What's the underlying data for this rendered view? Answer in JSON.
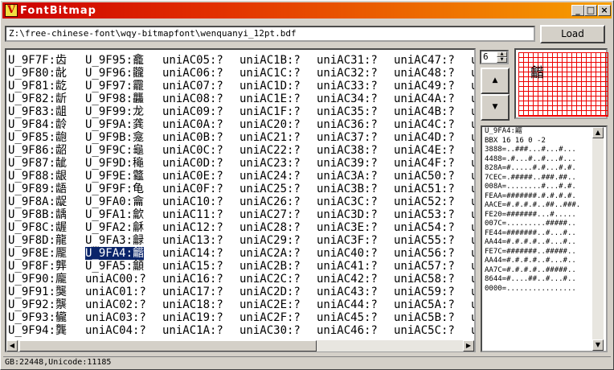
{
  "window": {
    "title": "FontBitmap",
    "icon_letter": "V",
    "controls": [
      "_",
      "□",
      "×"
    ]
  },
  "path_input": {
    "value": "Z:\\free-chinese-font\\wqy-bitmapfont\\wenquanyi_12pt.bdf"
  },
  "load_button": {
    "label": "Load"
  },
  "glyph_list": {
    "columns": [
      [
        "U_9F7F:齿",
        "U_9F80:龀",
        "U_9F81:龁",
        "U_9F82:龂",
        "U_9F83:龃",
        "U_9F84:龄",
        "U_9F85:龅",
        "U_9F86:龆",
        "U_9F87:龇",
        "U_9F88:龈",
        "U_9F89:龉",
        "U_9F8A:龊",
        "U_9F8B:龋",
        "U_9F8C:龌",
        "U_9F8D:龍",
        "U_9F8E:龎",
        "U_9F8F:龏",
        "U_9F90:龐",
        "U_9F91:龑",
        "U_9F92:龒",
        "U_9F93:龓",
        "U_9F94:龔"
      ],
      [
        "U_9F95:龕",
        "U_9F96:龖",
        "U_9F97:龗",
        "U_9F98:龘",
        "U_9F99:龙",
        "U_9F9A:龚",
        "U_9F9B:龛",
        "U_9F9C:龜",
        "U_9F9D:龝",
        "U_9F9E:龞",
        "U_9F9F:龟",
        "U_9FA0:龠",
        "U_9FA1:龡",
        "U_9FA2:龢",
        "U_9FA3:龣",
        "U_9FA4:龤",
        "U_9FA5:龥",
        "uniAC00:?",
        "uniAC01:?",
        "uniAC02:?",
        "uniAC03:?",
        "uniAC04:?"
      ],
      [
        "uniAC05:?",
        "uniAC06:?",
        "uniAC07:?",
        "uniAC08:?",
        "uniAC09:?",
        "uniAC0A:?",
        "uniAC0B:?",
        "uniAC0C:?",
        "uniAC0D:?",
        "uniAC0E:?",
        "uniAC0F:?",
        "uniAC10:?",
        "uniAC11:?",
        "uniAC12:?",
        "uniAC13:?",
        "uniAC14:?",
        "uniAC15:?",
        "uniAC16:?",
        "uniAC17:?",
        "uniAC18:?",
        "uniAC19:?",
        "uniAC1A:?"
      ],
      [
        "uniAC1B:?",
        "uniAC1C:?",
        "uniAC1D:?",
        "uniAC1E:?",
        "uniAC1F:?",
        "uniAC20:?",
        "uniAC21:?",
        "uniAC22:?",
        "uniAC23:?",
        "uniAC24:?",
        "uniAC25:?",
        "uniAC26:?",
        "uniAC27:?",
        "uniAC28:?",
        "uniAC29:?",
        "uniAC2A:?",
        "uniAC2B:?",
        "uniAC2C:?",
        "uniAC2D:?",
        "uniAC2E:?",
        "uniAC2F:?",
        "uniAC30:?"
      ],
      [
        "uniAC31:?",
        "uniAC32:?",
        "uniAC33:?",
        "uniAC34:?",
        "uniAC35:?",
        "uniAC36:?",
        "uniAC37:?",
        "uniAC38:?",
        "uniAC39:?",
        "uniAC3A:?",
        "uniAC3B:?",
        "uniAC3C:?",
        "uniAC3D:?",
        "uniAC3E:?",
        "uniAC3F:?",
        "uniAC40:?",
        "uniAC41:?",
        "uniAC42:?",
        "uniAC43:?",
        "uniAC44:?",
        "uniAC45:?",
        "uniAC46:?"
      ],
      [
        "uniAC47:?",
        "uniAC48:?",
        "uniAC49:?",
        "uniAC4A:?",
        "uniAC4B:?",
        "uniAC4C:?",
        "uniAC4D:?",
        "uniAC4E:?",
        "uniAC4F:?",
        "uniAC50:?",
        "uniAC51:?",
        "uniAC52:?",
        "uniAC53:?",
        "uniAC54:?",
        "uniAC55:?",
        "uniAC56:?",
        "uniAC57:?",
        "uniAC58:?",
        "uniAC59:?",
        "uniAC5A:?",
        "uniAC5B:?",
        "uniAC5C:?"
      ],
      [
        "u",
        "u",
        "u",
        "u",
        "u",
        "u",
        "u",
        "u",
        "u",
        "u",
        "u",
        "u",
        "u",
        "u",
        "u",
        "u",
        "u",
        "u",
        "u",
        "u",
        "u",
        "u"
      ]
    ],
    "selected": "U_9FA4:龤"
  },
  "size_spinner": {
    "value": "6"
  },
  "nav_buttons": {
    "up": "▲",
    "down": "▼"
  },
  "preview": {
    "glyph": "龤"
  },
  "bdf_text": {
    "lines": [
      "U_9FA4:龤",
      "BBX 16 16 0 -2",
      "3888=..###...#...#...",
      "4488=.#...#..#...#...",
      "828A=#.....#.#...#.#.",
      "7CEC=.#####..###.##..",
      "008A=........#...#.#.",
      "FEAA=#######.#.#.#.#.",
      "AACE=#.#.#.#..##..###.",
      "FE20=#######...#.....",
      "007C=.........#####..",
      "FE44=#######..#...#..",
      "AA44=#.#.#.#..#...#..",
      "FE7C=#######..#####..",
      "AA44=#.#.#.#..#...#..",
      "AA7C=#.#.#.#..#####..",
      "8644=#....##..#...#..",
      "0000=................"
    ]
  },
  "status": {
    "text": "GB:22448,Unicode:11185"
  }
}
